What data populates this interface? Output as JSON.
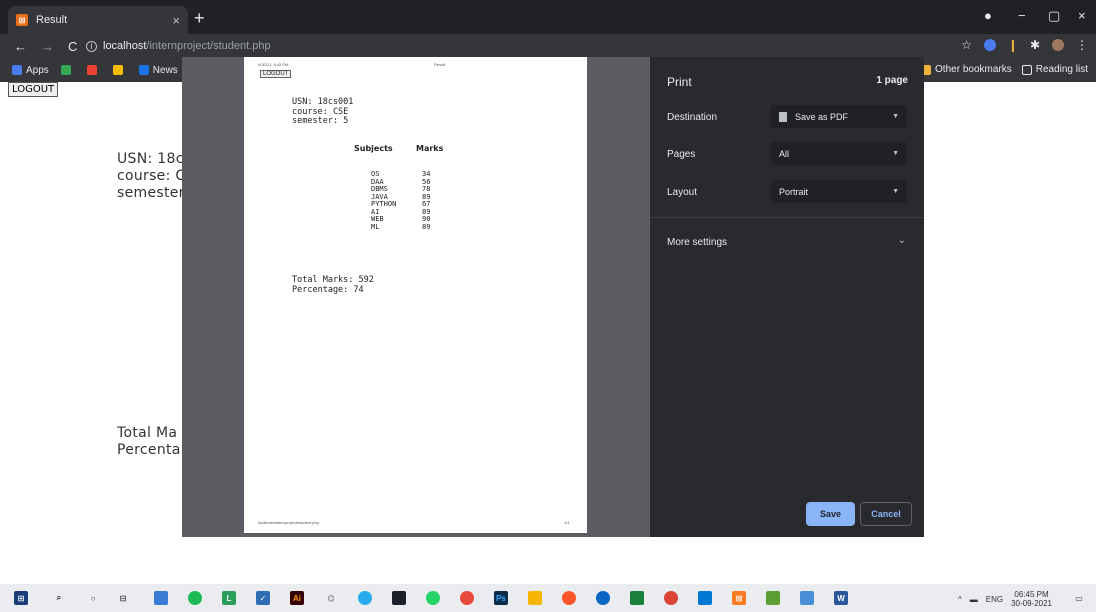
{
  "browser": {
    "tab_title": "Result",
    "tab_close": "×",
    "new_tab": "+",
    "url_host": "localhost",
    "url_path": "/internproject/student.php",
    "window_min": "−",
    "window_max": "▢",
    "window_close": "×"
  },
  "bookmarks": {
    "apps": "Apps",
    "news": "News",
    "other": "Other bookmarks",
    "reading": "Reading list"
  },
  "page": {
    "logout": "LOGOUT",
    "usn_partial": "USN: 18c",
    "course_partial": "course: C",
    "semester_partial": "semester",
    "total_partial": "Total Ma",
    "percent_partial": "Percenta"
  },
  "preview": {
    "header_date": "9/30/21, 6:45 PM",
    "header_title": "Result",
    "logout": "LOGOUT",
    "usn": "USN: 18cs001",
    "course": "course: CSE",
    "semester": "semester: 5",
    "col_subjects": "Subjects",
    "col_marks": "Marks",
    "rows": [
      {
        "subject": "OS",
        "marks": "34"
      },
      {
        "subject": "DAA",
        "marks": "56"
      },
      {
        "subject": "DBMS",
        "marks": "78"
      },
      {
        "subject": "JAVA",
        "marks": "89"
      },
      {
        "subject": "PYTHON",
        "marks": "67"
      },
      {
        "subject": "AI",
        "marks": "89"
      },
      {
        "subject": "WEB",
        "marks": "90"
      },
      {
        "subject": "ML",
        "marks": "89"
      }
    ],
    "total": "Total Marks: 592",
    "percentage": "Percentage: 74",
    "footer_url": "localhost/internproject/student.php",
    "footer_page": "1/1"
  },
  "print": {
    "title": "Print",
    "page_count": "1 page",
    "destination_label": "Destination",
    "destination_value": "Save as PDF",
    "pages_label": "Pages",
    "pages_value": "All",
    "layout_label": "Layout",
    "layout_value": "Portrait",
    "more_settings": "More settings",
    "save": "Save",
    "cancel": "Cancel"
  },
  "taskbar": {
    "lang": "ENG",
    "time": "06:45 PM",
    "date": "30-09-2021"
  }
}
